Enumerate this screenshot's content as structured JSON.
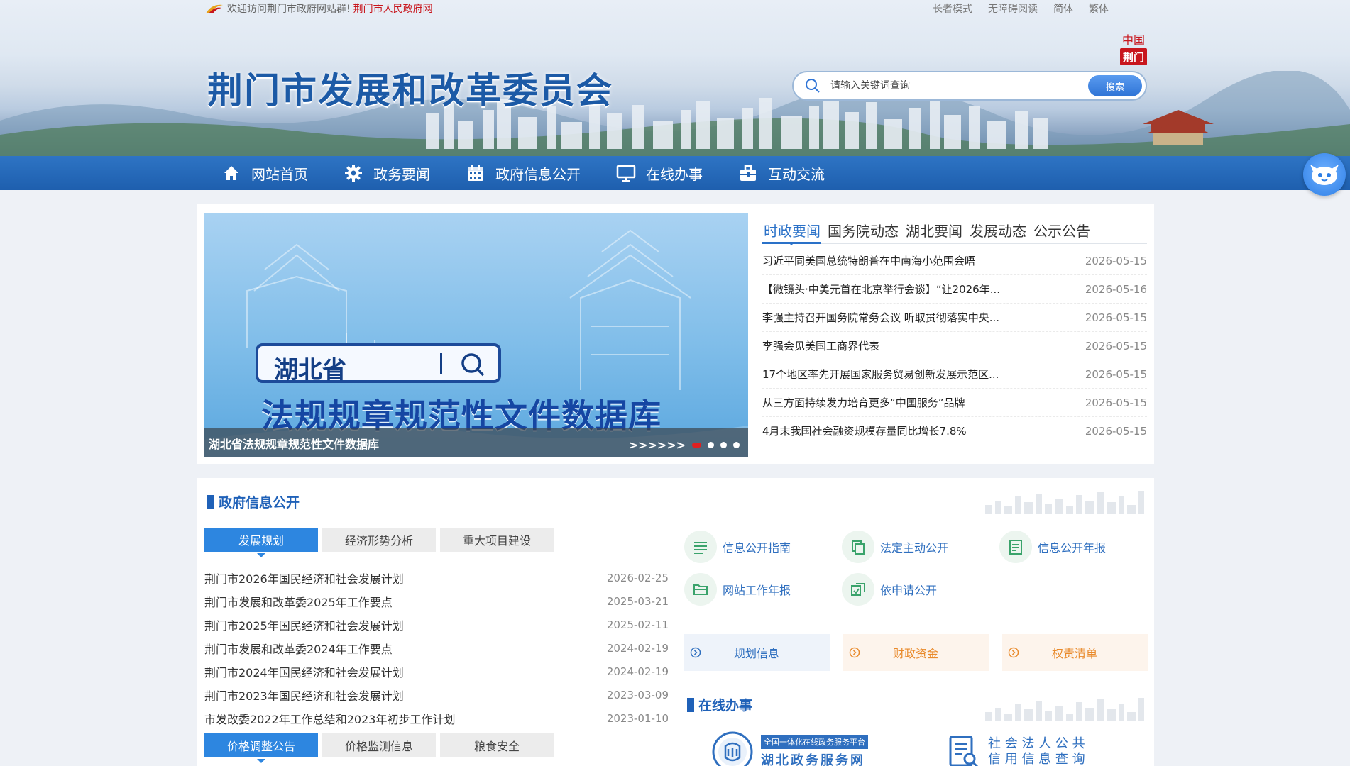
{
  "topbar": {
    "welcome": "欢迎访问荆门市政府网站群!",
    "gov_link": "荆门市人民政府网",
    "links": [
      "长者模式",
      "无障碍阅读",
      "简体",
      "繁体"
    ]
  },
  "header": {
    "site_title": "荆门市发展和改革委员会",
    "search_placeholder": "请输入关键词查询",
    "search_button": "搜索",
    "badge_top": "中国",
    "badge_bottom": "荆门"
  },
  "nav": {
    "items": [
      {
        "label": "网站首页",
        "icon": "home-icon"
      },
      {
        "label": "政务要闻",
        "icon": "gear-icon"
      },
      {
        "label": "政府信息公开",
        "icon": "calendar-icon"
      },
      {
        "label": "在线办事",
        "icon": "monitor-icon"
      },
      {
        "label": "互动交流",
        "icon": "briefcase-icon"
      }
    ]
  },
  "slider": {
    "province": "湖北省",
    "headline": "法规规章规范性文件数据库",
    "caption": "湖北省法规规章规范性文件数据库",
    "arrows": ">>>>>>"
  },
  "news": {
    "tabs": [
      "时政要闻",
      "国务院动态",
      "湖北要闻",
      "发展动态",
      "公示公告"
    ],
    "active_tab": "时政要闻",
    "items": [
      {
        "title": "习近平同美国总统特朗普在中南海小范围会晤",
        "date": "2026-05-15"
      },
      {
        "title": "【微镜头·中美元首在北京举行会谈】“让2026年...",
        "date": "2026-05-16"
      },
      {
        "title": "李强主持召开国务院常务会议 听取贯彻落实中央...",
        "date": "2026-05-15"
      },
      {
        "title": "李强会见美国工商界代表",
        "date": "2026-05-15"
      },
      {
        "title": "17个地区率先开展国家服务贸易创新发展示范区...",
        "date": "2026-05-15"
      },
      {
        "title": "从三方面持续发力培育更多“中国服务”品牌",
        "date": "2026-05-15"
      },
      {
        "title": "4月末我国社会融资规模存量同比增长7.8%",
        "date": "2026-05-15"
      }
    ]
  },
  "info": {
    "section_title": "政府信息公开",
    "subtabs": [
      "发展规划",
      "经济形势分析",
      "重大项目建设"
    ],
    "plans": [
      {
        "title": "荆门市2026年国民经济和社会发展计划",
        "date": "2026-02-25"
      },
      {
        "title": "荆门市发展和改革委2025年工作要点",
        "date": "2025-03-21"
      },
      {
        "title": "荆门市2025年国民经济和社会发展计划",
        "date": "2025-02-11"
      },
      {
        "title": "荆门市发展和改革委2024年工作要点",
        "date": "2024-02-19"
      },
      {
        "title": "荆门市2024年国民经济和社会发展计划",
        "date": "2024-02-19"
      },
      {
        "title": "荆门市2023年国民经济和社会发展计划",
        "date": "2023-03-09"
      },
      {
        "title": "市发改委2022年工作总结和2023年初步工作计划",
        "date": "2023-01-10"
      }
    ],
    "subtabs2": [
      "价格调整公告",
      "价格监测信息",
      "粮食安全"
    ],
    "quick_links": [
      {
        "label": "信息公开指南",
        "icon": "list-icon"
      },
      {
        "label": "法定主动公开",
        "icon": "copy-icon"
      },
      {
        "label": "信息公开年报",
        "icon": "report-icon"
      },
      {
        "label": "网站工作年报",
        "icon": "folder-icon"
      },
      {
        "label": "依申请公开",
        "icon": "apply-icon"
      }
    ],
    "categories": [
      "规划信息",
      "财政资金",
      "权责清单"
    ]
  },
  "online": {
    "section_title": "在线办事",
    "service1_badge": "全国一体化在线政务服务平台",
    "service1_name": "湖北政务服务网",
    "service2_line1": "社 会 法 人 公 共",
    "service2_line2": "信 用 信 息 查 询"
  },
  "colors": {
    "primary": "#1f61b8",
    "nav": "#2465b4",
    "accent_red": "#c8161d",
    "orange": "#e98a2b"
  }
}
